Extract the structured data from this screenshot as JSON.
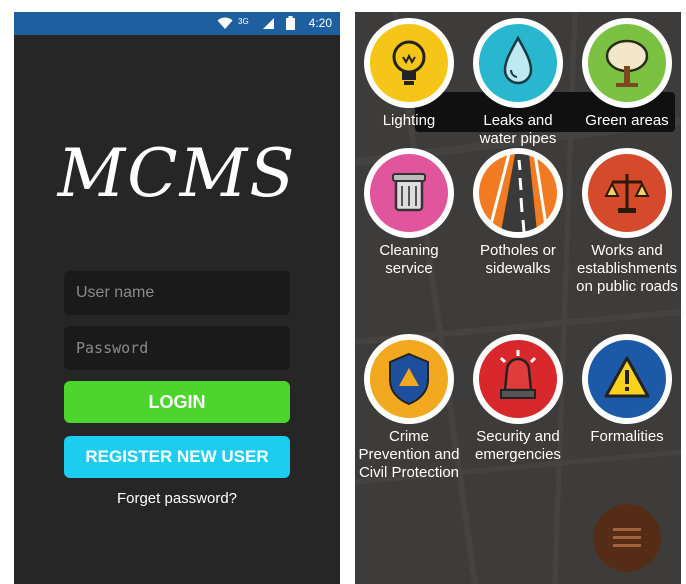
{
  "login_screen": {
    "status_bar": {
      "time": "4:20",
      "network": "3G"
    },
    "logo": "MCMS",
    "username_placeholder": "User name",
    "password_placeholder": "Password",
    "login_label": "LOGIN",
    "register_label": "REGISTER NEW USER",
    "forget_label": "Forget password?"
  },
  "categories_screen": {
    "tiles": [
      {
        "label": "Lighting",
        "icon": "lightbulb-icon",
        "color": "#f5c518"
      },
      {
        "label": "Leaks and water pipes",
        "icon": "water-drop-icon",
        "color": "#29b6cf"
      },
      {
        "label": "Green areas",
        "icon": "tree-icon",
        "color": "#7cc242"
      },
      {
        "label": "Cleaning service",
        "icon": "trash-bin-icon",
        "color": "#e0559b"
      },
      {
        "label": "Potholes or sidewalks",
        "icon": "road-icon",
        "color": "#f07b22"
      },
      {
        "label": "Works and establishments on public roads",
        "icon": "scales-icon",
        "color": "#d44a2a"
      },
      {
        "label": "Crime Prevention and Civil Protection",
        "icon": "shield-icon",
        "color": "#f3a91f"
      },
      {
        "label": "Security and emergencies",
        "icon": "siren-icon",
        "color": "#d8282c"
      },
      {
        "label": "Formalities",
        "icon": "warning-icon",
        "color": "#1c5aa8"
      }
    ],
    "menu_icon": "hamburger-menu-icon"
  }
}
